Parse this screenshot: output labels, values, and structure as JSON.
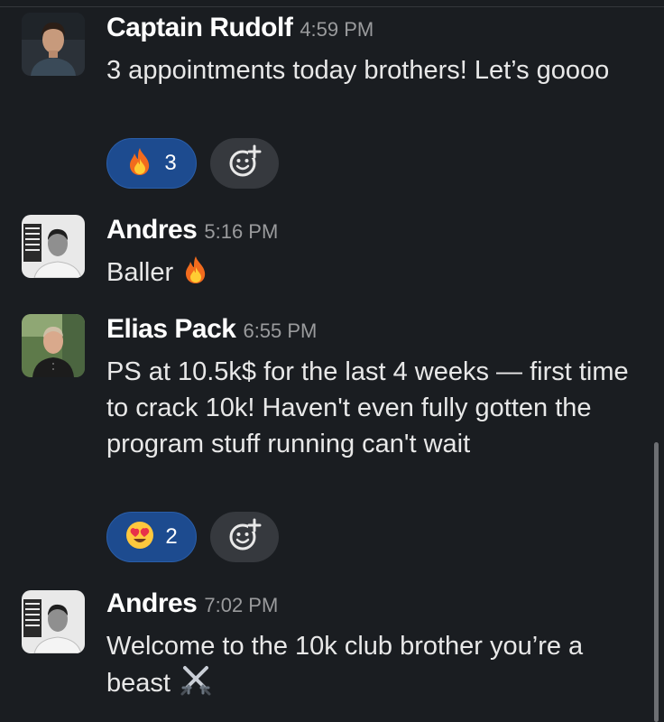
{
  "messages": [
    {
      "author": "Captain Rudolf",
      "time": "4:59 PM",
      "text": "3 appointments today brothers! Let’s goooo",
      "reaction": {
        "emoji": "fire",
        "count": "3"
      }
    },
    {
      "author": "Andres",
      "time": "5:16 PM",
      "text": "Baller",
      "inline_emoji": "fire"
    },
    {
      "author": "Elias Pack",
      "time": "6:55 PM",
      "text": "PS at 10.5k$ for the last 4 weeks — first time to crack 10k! Haven't even fully gotten the program stuff running can't wait",
      "reaction": {
        "emoji": "heart-eyes",
        "count": "2"
      }
    },
    {
      "author": "Andres",
      "time": "7:02 PM",
      "text": "Welcome to the 10k club brother you’re a beast",
      "inline_emoji": "crossed-swords"
    }
  ],
  "theme": {
    "background": "#1a1d21",
    "reaction_active": "#1d4b8f",
    "add_reaction_bg": "#36393e"
  }
}
